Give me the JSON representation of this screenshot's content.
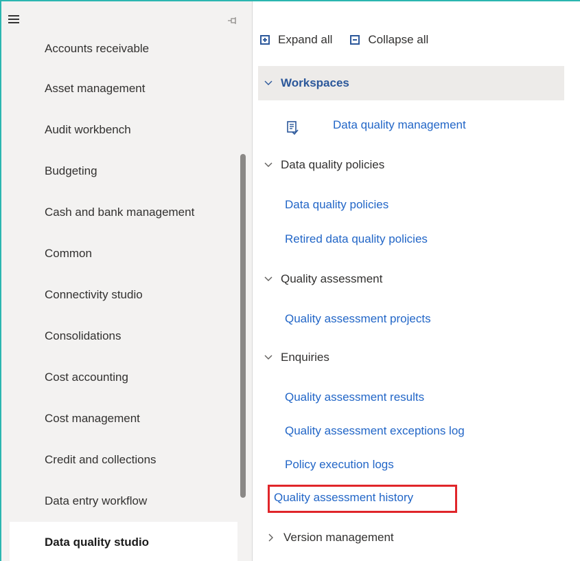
{
  "nav": {
    "items": [
      {
        "label": "Accounts receivable"
      },
      {
        "label": "Asset management"
      },
      {
        "label": "Audit workbench"
      },
      {
        "label": "Budgeting"
      },
      {
        "label": "Cash and bank management"
      },
      {
        "label": "Common"
      },
      {
        "label": "Connectivity studio"
      },
      {
        "label": "Consolidations"
      },
      {
        "label": "Cost accounting"
      },
      {
        "label": "Cost management"
      },
      {
        "label": "Credit and collections"
      },
      {
        "label": "Data entry workflow"
      },
      {
        "label": "Data quality studio"
      }
    ],
    "active_index": 12
  },
  "toolbar": {
    "expand_label": "Expand all",
    "collapse_label": "Collapse all"
  },
  "groups": {
    "workspaces": {
      "label": "Workspaces",
      "links": [
        "Data quality management"
      ]
    },
    "policies": {
      "label": "Data quality policies",
      "links": [
        "Data quality policies",
        "Retired data quality policies"
      ]
    },
    "assessment": {
      "label": "Quality assessment",
      "links": [
        "Quality assessment projects"
      ]
    },
    "enquiries": {
      "label": "Enquiries",
      "links": [
        "Quality assessment results",
        "Quality assessment exceptions log",
        "Policy execution logs",
        "Quality assessment history"
      ]
    },
    "version": {
      "label": "Version management"
    }
  },
  "colors": {
    "link": "#2266c7",
    "accent_border": "#2bb6b0",
    "highlight": "#e0252a"
  },
  "icons": {
    "menu": "hamburger-menu-icon",
    "pin": "pin-icon",
    "expand": "expand-all-icon",
    "collapse": "collapse-all-icon",
    "workspace": "workspace-icon",
    "chevron_down": "chevron-down-icon",
    "chevron_right": "chevron-right-icon"
  }
}
